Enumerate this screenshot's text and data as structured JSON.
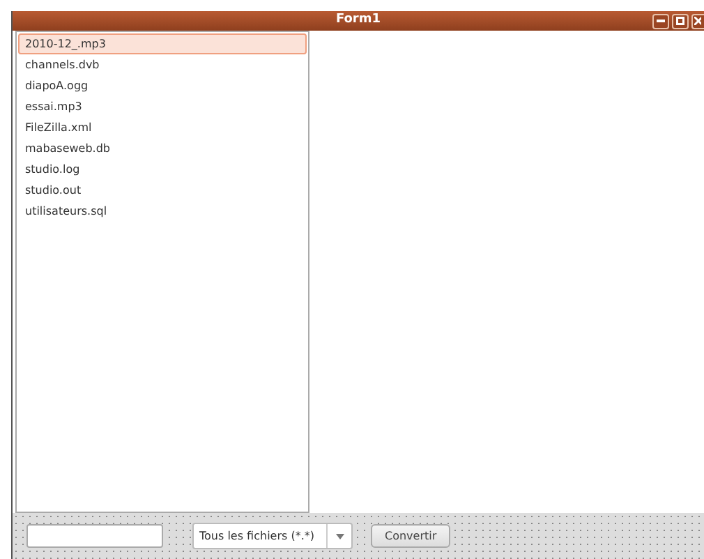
{
  "window": {
    "title": "Form1"
  },
  "files": [
    {
      "name": "2010-12_.mp3",
      "selected": true
    },
    {
      "name": "channels.dvb",
      "selected": false
    },
    {
      "name": "diapoA.ogg",
      "selected": false
    },
    {
      "name": "essai.mp3",
      "selected": false
    },
    {
      "name": "FileZilla.xml",
      "selected": false
    },
    {
      "name": "mabaseweb.db",
      "selected": false
    },
    {
      "name": "studio.log",
      "selected": false
    },
    {
      "name": "studio.out",
      "selected": false
    },
    {
      "name": "utilisateurs.sql",
      "selected": false
    }
  ],
  "toolbar": {
    "filter": {
      "value": "Tous les fichiers (*.*)"
    },
    "convert_button": "Convertir"
  }
}
